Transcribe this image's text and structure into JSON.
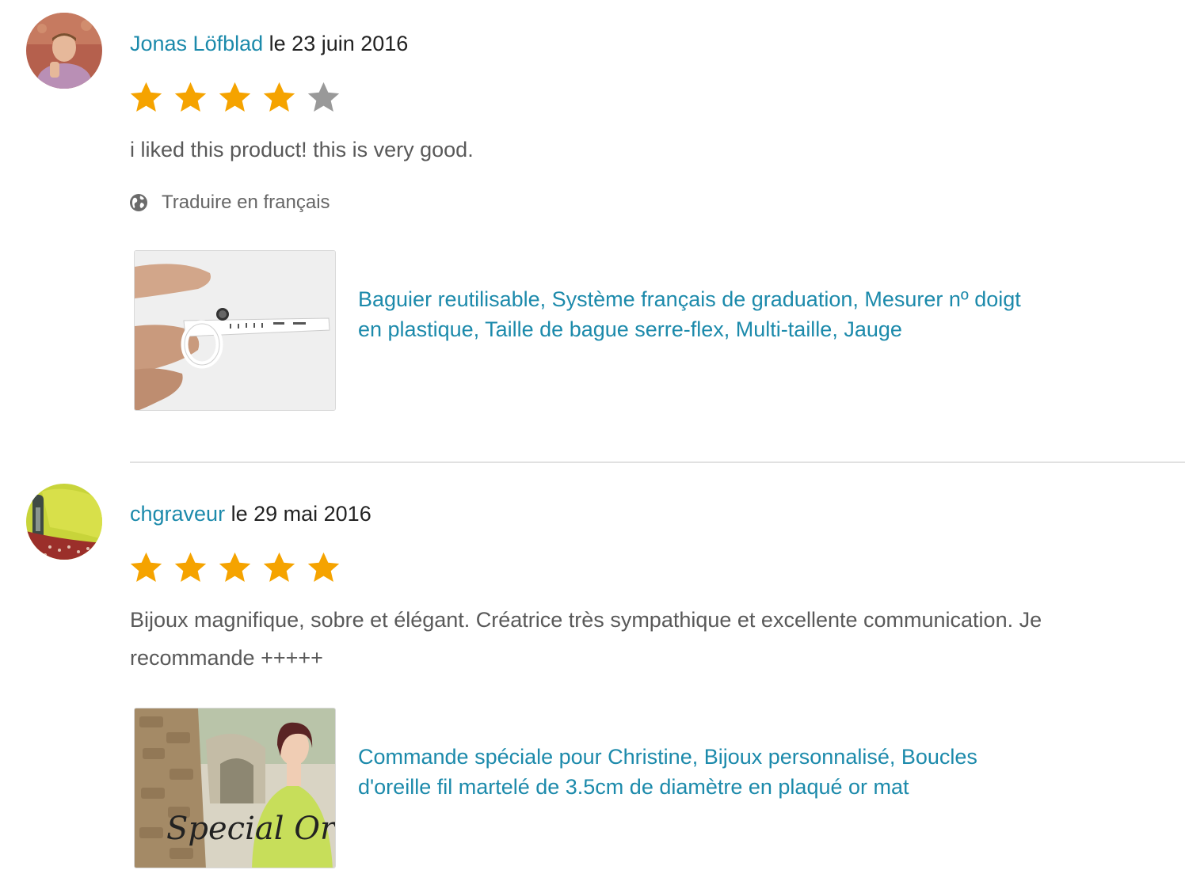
{
  "colors": {
    "link": "#1c8aab",
    "star_filled": "#f5a300",
    "star_empty": "#999999",
    "text_body": "#595959",
    "divider": "#e1e1e1"
  },
  "reviews": [
    {
      "reviewer": "Jonas Löfblad",
      "date": "le 23 juin 2016",
      "rating": 4,
      "rating_max": 5,
      "text": "i liked this product! this is very good.",
      "translate_label": "Traduire en français",
      "translate_icon": "globe-icon",
      "product": {
        "title": "Baguier reutilisable, Système français de graduation, Mesurer nº doigt en plastique, Taille de bague serre-flex, Multi-taille, Jauge"
      }
    },
    {
      "reviewer": "chgraveur",
      "date": "le 29 mai 2016",
      "rating": 5,
      "rating_max": 5,
      "text": "Bijoux magnifique, sobre et élégant. Créatrice très sympathique et excellente communication. Je recommande +++++",
      "product": {
        "title": "Commande spéciale pour Christine, Bijoux personnalisé, Boucles d'oreille fil martelé de 3.5cm de diamètre en plaqué or mat",
        "image_caption": "Special Order"
      }
    }
  ]
}
